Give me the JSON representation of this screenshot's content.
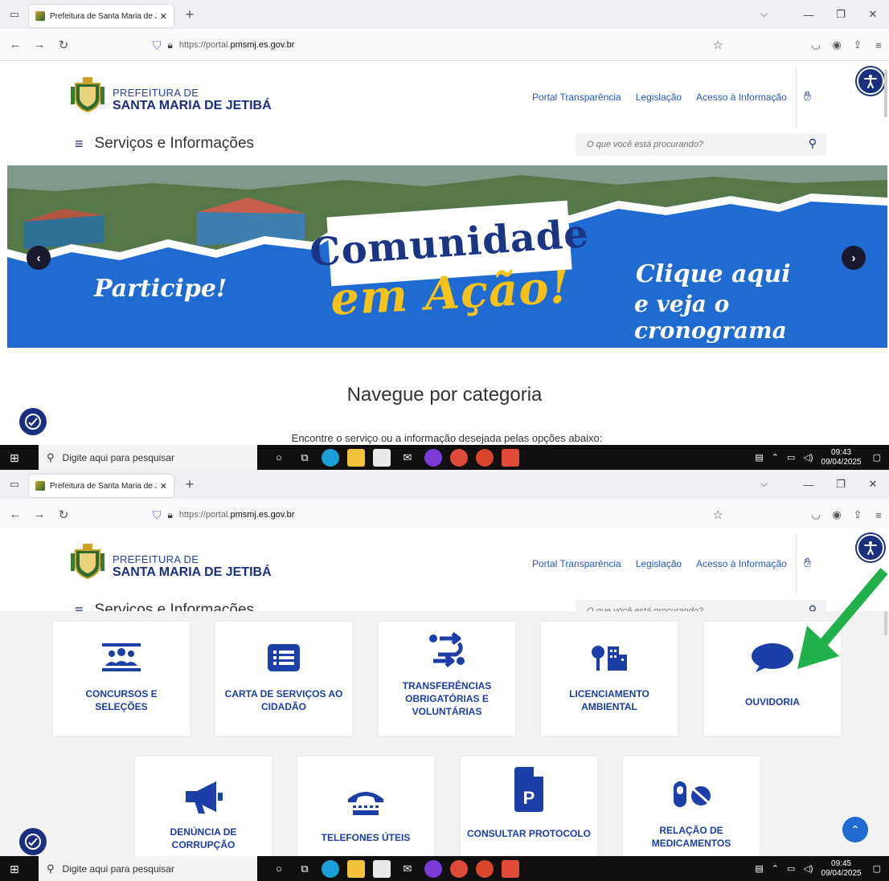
{
  "browser": {
    "tab_title": "Prefeitura de Santa Maria de Je",
    "url_host_prefix": "https://portal.",
    "url_host_bold": "pmsmj.es.gov.br"
  },
  "header": {
    "brand_top": "PREFEITURA DE",
    "brand_bottom": "SANTA MARIA DE JETIBÁ",
    "links": [
      "Portal Transparência",
      "Legislação",
      "Acesso à Informação"
    ],
    "menu_label": "Serviços e Informações",
    "search_placeholder": "O que você está procurando?"
  },
  "banner": {
    "title": "Comunidade",
    "subtitle": "em Ação!",
    "left_text": "Participe!",
    "right_line1": "Clique aqui",
    "right_line2": "e veja o cronograma"
  },
  "section": {
    "heading": "Navegue por categoria",
    "subheading": "Encontre o serviço ou a informação desejada pelas opções abaixo:"
  },
  "taskbar": {
    "search_placeholder": "Digite aqui para pesquisar",
    "date": "09/04/2025",
    "time_1": "09:43",
    "time_2": "09:45"
  },
  "cards": [
    {
      "label": "CONCURSOS E SELEÇÕES",
      "icon": "people-group-icon"
    },
    {
      "label": "CARTA DE SERVIÇOS AO CIDADÃO",
      "icon": "list-icon"
    },
    {
      "label": "TRANSFERÊNCIAS OBRIGATÓRIAS E VOLUNTÁRIAS",
      "icon": "transfer-arrows-icon"
    },
    {
      "label": "LICENCIAMENTO AMBIENTAL",
      "icon": "tree-building-icon"
    },
    {
      "label": "OUVIDORIA",
      "icon": "speech-bubble-icon"
    },
    {
      "label": "DENÚNCIA DE CORRUPÇÃO",
      "icon": "megaphone-icon"
    },
    {
      "label": "TELEFONES ÚTEIS",
      "icon": "telephone-icon"
    },
    {
      "label": "CONSULTAR PROTOCOLO",
      "icon": "document-p-icon"
    },
    {
      "label": "RELAÇÃO DE MEDICAMENTOS",
      "icon": "pills-icon"
    }
  ],
  "colors": {
    "brand_blue": "#1b2f80",
    "card_text": "#1b3fa6",
    "banner_blue": "#1f6bd1",
    "banner_yellow": "#f5c21a",
    "annotation_arrow": "#22b04b"
  }
}
